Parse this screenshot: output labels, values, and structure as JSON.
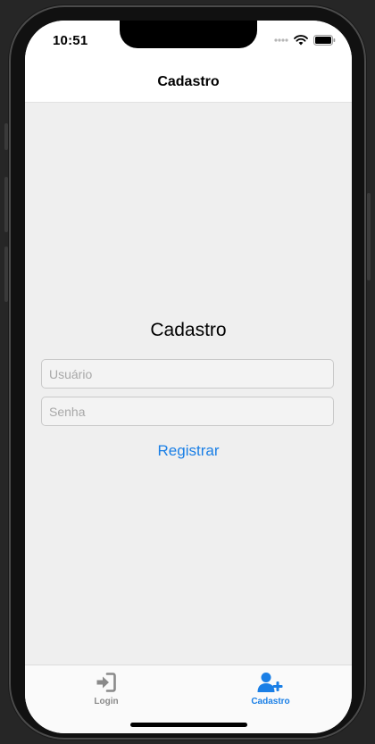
{
  "status_bar": {
    "time": "10:51",
    "icons": [
      "signal-dots-icon",
      "wifi-icon",
      "battery-icon"
    ]
  },
  "nav": {
    "title": "Cadastro"
  },
  "form": {
    "title": "Cadastro",
    "username": {
      "value": "",
      "placeholder": "Usuário"
    },
    "password": {
      "value": "",
      "placeholder": "Senha"
    },
    "register_label": "Registrar"
  },
  "tabs": [
    {
      "label": "Login",
      "icon": "sign-in-icon",
      "active": false
    },
    {
      "label": "Cadastro",
      "icon": "user-plus-icon",
      "active": true
    }
  ],
  "colors": {
    "accent": "#1a7fe6",
    "inactive": "#8a8a8a",
    "content_background": "#efefef"
  }
}
